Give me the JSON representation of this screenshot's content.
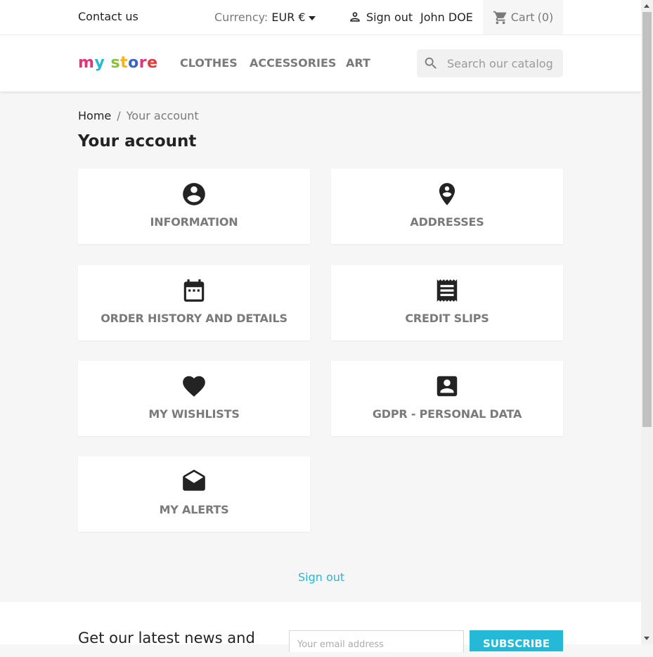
{
  "topbar": {
    "contact": "Contact us",
    "currency_label": "Currency:",
    "currency_value": "EUR €",
    "sign_out": "Sign out",
    "user": "John DOE",
    "cart": "Cart",
    "cart_count": "(0)"
  },
  "header": {
    "logo": [
      "m",
      "y",
      " ",
      "s",
      "t",
      "o",
      "r",
      "e"
    ],
    "menu": [
      "CLOTHES",
      "ACCESSORIES",
      "ART"
    ],
    "search_placeholder": "Search our catalog"
  },
  "breadcrumb": {
    "home": "Home",
    "separator": "/",
    "current": "Your account"
  },
  "page_title": "Your account",
  "links": [
    {
      "label": "INFORMATION",
      "icon": "account-circle-icon"
    },
    {
      "label": "ADDRESSES",
      "icon": "location-pin-icon"
    },
    {
      "label": "ORDER HISTORY AND DETAILS",
      "icon": "calendar-icon"
    },
    {
      "label": "CREDIT SLIPS",
      "icon": "receipt-icon"
    },
    {
      "label": "MY WISHLISTS",
      "icon": "heart-icon"
    },
    {
      "label": "GDPR - PERSONAL DATA",
      "icon": "account-box-icon"
    },
    {
      "label": "MY ALERTS",
      "icon": "open-envelope-icon"
    }
  ],
  "sign_out_link": "Sign out",
  "footer": {
    "newsletter_text": "Get our latest news and",
    "email_placeholder": "Your email address",
    "subscribe": "SUBSCRIBE"
  },
  "colors": {
    "accent": "#24b9d7",
    "text": "#232323",
    "muted": "#7a7a7a",
    "background": "#f6f6f6"
  }
}
